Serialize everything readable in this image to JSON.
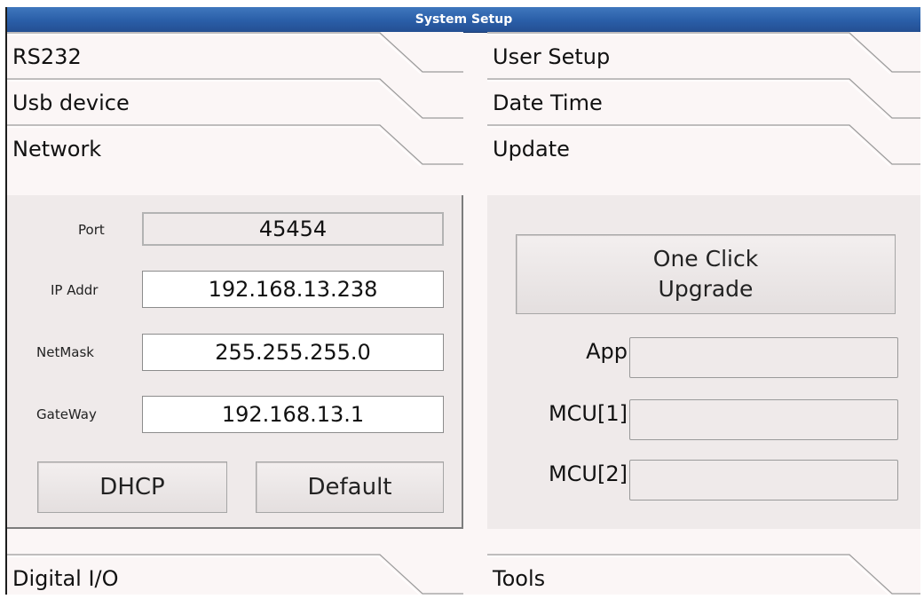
{
  "window": {
    "title": "System Setup"
  },
  "left_tabs": {
    "rs232": "RS232",
    "usb_device": "Usb device",
    "network": "Network",
    "digital_io": "Digital I/O"
  },
  "right_tabs": {
    "user_setup": "User Setup",
    "date_time": "Date Time",
    "update": "Update",
    "tools": "Tools"
  },
  "network": {
    "port_label": "Port",
    "port_value": "45454",
    "ip_label": "IP Addr",
    "ip_value": "192.168.13.238",
    "netmask_label": "NetMask",
    "netmask_value": "255.255.255.0",
    "gateway_label": "GateWay",
    "gateway_value": "192.168.13.1",
    "dhcp_button": "DHCP",
    "default_button": "Default"
  },
  "update": {
    "upgrade_line1": "One Click",
    "upgrade_line2": "Upgrade",
    "app_label": "App",
    "app_value": "",
    "mcu1_label": "MCU[1]",
    "mcu1_value": "",
    "mcu2_label": "MCU[2]",
    "mcu2_value": ""
  }
}
